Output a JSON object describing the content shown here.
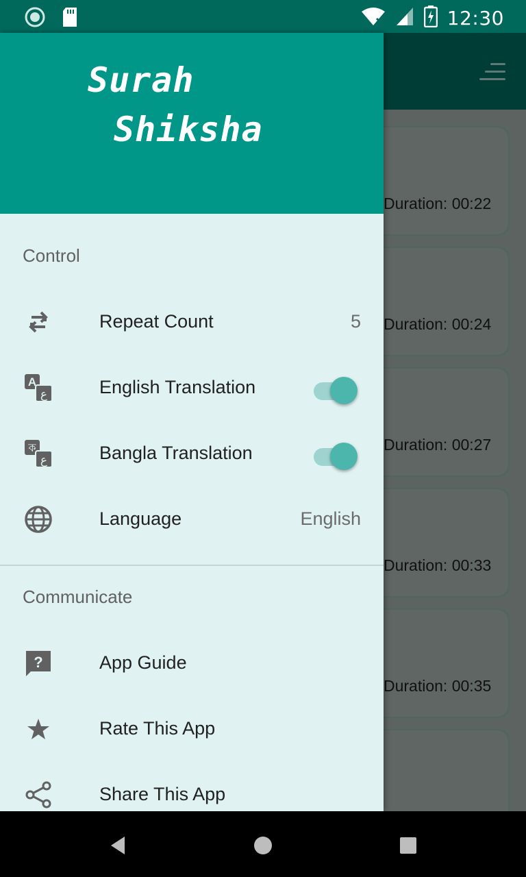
{
  "status_bar": {
    "time": "12:30",
    "icons": [
      "app-notification-icon",
      "sd-card-icon",
      "wifi-icon",
      "signal-icon",
      "battery-charging-icon"
    ]
  },
  "background": {
    "menu_icon": "sort-menu-icon",
    "cards": [
      {
        "duration": "Duration: 00:22"
      },
      {
        "duration": "Duration: 00:24"
      },
      {
        "duration": "Duration: 00:27"
      },
      {
        "duration": "Duration: 00:33"
      },
      {
        "duration": "Duration: 00:35"
      },
      {
        "duration": ""
      }
    ]
  },
  "drawer": {
    "header": {
      "title_line1": "Surah",
      "title_line2": "Shiksha",
      "bg_color": "#009688"
    },
    "control": {
      "title": "Control",
      "items": [
        {
          "label": "Repeat Count",
          "value": "5",
          "icon": "repeat-icon"
        },
        {
          "label": "English Translation",
          "toggle": true,
          "icon": "translate-english-icon"
        },
        {
          "label": "Bangla Translation",
          "toggle": true,
          "icon": "translate-bangla-icon"
        },
        {
          "label": "Language",
          "value": "English",
          "icon": "globe-icon"
        }
      ]
    },
    "communicate": {
      "title": "Communicate",
      "items": [
        {
          "label": "App Guide",
          "icon": "help-icon"
        },
        {
          "label": "Rate This App",
          "icon": "star-icon"
        },
        {
          "label": "Share This App",
          "icon": "share-icon"
        }
      ]
    }
  },
  "nav_bar": {
    "buttons": [
      "back-icon",
      "home-icon",
      "recents-icon"
    ]
  },
  "colors": {
    "primary": "#009688",
    "primary_dark": "#00695c",
    "accent": "#4db6ac",
    "drawer_bg": "#e0f2f1"
  }
}
